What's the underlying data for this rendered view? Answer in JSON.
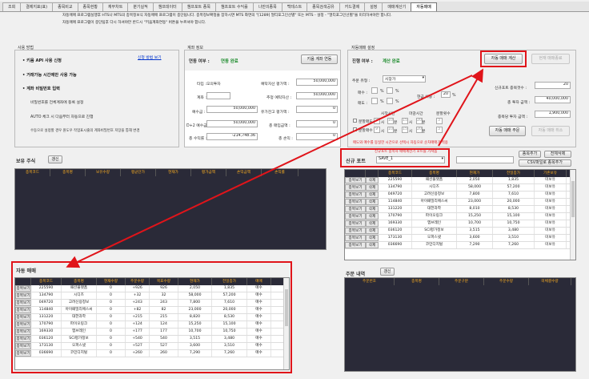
{
  "tabs": [
    "조회",
    "결제지표(표)",
    "종목비교",
    "종목현황",
    "재무차트",
    "분기실적",
    "챔프데이터",
    "챔프포트 종목",
    "챔프포트 수익률",
    "나만의종목",
    "백테스트",
    "종목검색공유",
    "카드결제",
    "설정",
    "매매계산기",
    "자동매매"
  ],
  "active_tab_index": 15,
  "notice": {
    "line1": "자동매매 프로그램실행후 HTS나 MTS의 종목정보식 자동매매 프로그램이 종단됩니다. 종목정보확정을 잡하시면 MTS 화면의 \"[1289] 멀티포그인선별\" 또는 MTS - 설정 - \"멀티포그인선별\"을 미리하셔야만 합니다.",
    "line2": "자동매매 프로그램이 중단팀후 다시 하셔야만 반드시 \"키움계좌연동\" 버튼을 누르셔야 합니다."
  },
  "usage": {
    "title": "사용 방법",
    "items": [
      "키움 API 사용 신청",
      "거래가능 시간에만 사용 가능",
      "계좌 비밀번호 입력"
    ],
    "link": "신청 방법 보기",
    "notes": [
      "비밀번호를 전체계좌에 등록 설정",
      "AUTO 체크 시 다음부터 자동으로 진행",
      "수동으로 설정할 경우 원도우 작업표시줄의 계좌비밀번호 저장을 통해 변경"
    ]
  },
  "account": {
    "title": "계좌 정보",
    "link_label": "연동 여부 :",
    "link_status": "연동 완료",
    "link_button": "키움 계좌 연동",
    "type_label": "타입 :",
    "type_value": "모의투자",
    "account_label": "계좌 :",
    "account_value": "",
    "deposit_label": "예수금 :",
    "deposit_value": "50,000,000",
    "d2_label": "D+2 예수금 :",
    "d2_value": "50,000,000",
    "total_profit_label": "총 수익률 :",
    "total_profit_value": "-214,748.36",
    "eval_assets_label": "예탁자산 평가액 :",
    "eval_assets_value": "50,000,000",
    "est_assets_label": "추정 예탁자산 :",
    "est_assets_value": "50,000,000",
    "stock_eval_label": "유가잔고 평가액 :",
    "stock_eval_value": "0",
    "total_buy_label": "총 매입금액 :",
    "total_buy_value": "0",
    "total_pl_label": "총 손익 :",
    "total_pl_value": "0"
  },
  "auto_settings": {
    "title": "자동매매 설정",
    "status_label": "진행 여부 :",
    "status_value": "계산 완료",
    "calc_button": "자동 매매 계산",
    "cancel_button": "현재 매매종료",
    "order_type_label": "주문 유형 :",
    "order_type_value": "시장가",
    "buy_label": "매수 :",
    "sell_label": "매도 :",
    "pct": "%",
    "cash_ratio_label": "현금 비중 :",
    "cash_ratio_value": "20",
    "new_count_label": "신규포트 종목갯수 :",
    "new_count_value": "20",
    "total_invest_label": "총 투자 금액 :",
    "total_invest_value": "40,000,000",
    "per_stock_label": "종목당 투자 금액 :",
    "per_stock_value": "1,900,000",
    "start_time": "시작시간",
    "end_time": "마감시간",
    "split_count": "분할횟수",
    "row1_label": "분할매도",
    "row2_label": "분할매수",
    "time_values": [
      "9",
      "시",
      "10",
      "분",
      "15",
      "시",
      "20",
      "분",
      "3"
    ],
    "order_button": "자동 매매 주문",
    "order_cancel_button": "자동 매매 취소",
    "warning": "매도와 매수를 동일한 시간으로 선택시 자동으로 순차매매가 적용"
  },
  "holdings": {
    "title": "보유 주식",
    "refresh": "갱신",
    "columns": [
      "종목코드",
      "종목명",
      "보유수량",
      "평균단가",
      "현재가",
      "평가금액",
      "손익금액",
      "손익률"
    ]
  },
  "new_port": {
    "hint": "신규포트 종목사 매매계산기 포트를 가져옴",
    "label": "신규 포트",
    "value": "SAVE_1",
    "add_button": "종목추가",
    "delete_all_button": "전체삭제",
    "csv_button": "CSV파일로 종목추가",
    "columns": [
      "",
      "",
      "종목코드",
      "종목명",
      "현재가",
      "전일종가",
      "기존보유"
    ],
    "rows": [
      [
        "종목보기",
        "삭제",
        "225590",
        "패션플랫폼",
        "2,050",
        "1,835",
        "미보유"
      ],
      [
        "종목보기",
        "삭제",
        "134790",
        "시디즈",
        "58,000",
        "57,200",
        "미보유"
      ],
      [
        "종목보기",
        "삭제",
        "049720",
        "고려신용정보",
        "7,800",
        "7,610",
        "미보유"
      ],
      [
        "종목보기",
        "삭제",
        "114840",
        "아이패밀리에스씨",
        "23,000",
        "20,000",
        "미보유"
      ],
      [
        "종목보기",
        "삭제",
        "131220",
        "대한과학",
        "8,010",
        "8,530",
        "미보유"
      ],
      [
        "종목보기",
        "삭제",
        "170790",
        "파이오링크",
        "15,250",
        "15,100",
        "미보유"
      ],
      [
        "종목보기",
        "삭제",
        "169330",
        "엠브레인",
        "10,700",
        "10,750",
        "미보유"
      ],
      [
        "종목보기",
        "삭제",
        "036120",
        "SCI평가정보",
        "3,515",
        "3,480",
        "미보유"
      ],
      [
        "종목보기",
        "삭제",
        "173130",
        "오파스넷",
        "3,600",
        "3,510",
        "미보유"
      ],
      [
        "종목보기",
        "삭제",
        "036690",
        "코민디지털",
        "7,290",
        "7,260",
        "미보유"
      ]
    ]
  },
  "auto_trade": {
    "title": "자동 매매",
    "columns": [
      "",
      "종목코드",
      "종목명",
      "현재수량",
      "주문수량",
      "목표수량",
      "현재가",
      "전일종가",
      "매매"
    ],
    "rows": [
      [
        "종목보기",
        "225590",
        "패션플랫폼",
        "0",
        "+926",
        "926",
        "2,050",
        "1,835",
        "매수"
      ],
      [
        "종목보기",
        "134790",
        "시디즈",
        "0",
        "+32",
        "32",
        "58,000",
        "57,200",
        "매수"
      ],
      [
        "종목보기",
        "049720",
        "고려신용정보",
        "0",
        "+243",
        "243",
        "7,800",
        "7,610",
        "매수"
      ],
      [
        "종목보기",
        "114840",
        "아이패밀리에스씨",
        "0",
        "+82",
        "82",
        "23,000",
        "20,000",
        "매수"
      ],
      [
        "종목보기",
        "131220",
        "대한과학",
        "0",
        "+215",
        "215",
        "8,820",
        "8,530",
        "매수"
      ],
      [
        "종목보기",
        "170790",
        "파이오링크",
        "0",
        "+124",
        "124",
        "15,250",
        "15,100",
        "매수"
      ],
      [
        "종목보기",
        "169330",
        "엠브레인",
        "0",
        "+177",
        "177",
        "10,700",
        "10,750",
        "매수"
      ],
      [
        "종목보기",
        "036120",
        "SCI평가정보",
        "0",
        "+540",
        "540",
        "3,515",
        "3,480",
        "매수"
      ],
      [
        "종목보기",
        "173130",
        "오파스넷",
        "0",
        "+527",
        "527",
        "3,600",
        "3,510",
        "매수"
      ],
      [
        "종목보기",
        "036690",
        "코민디지털",
        "0",
        "+260",
        "260",
        "7,290",
        "7,260",
        "매수"
      ]
    ]
  },
  "orders": {
    "title": "주문 내역",
    "refresh": "갱신",
    "columns": [
      "주문번호",
      "종목명",
      "주문구분",
      "주문수량",
      "미체결수량"
    ]
  },
  "colors": {
    "highlight": "#e0141a",
    "grid_header": "#2a2a38",
    "header_text": "#ffb020",
    "link": "#0033cc"
  }
}
